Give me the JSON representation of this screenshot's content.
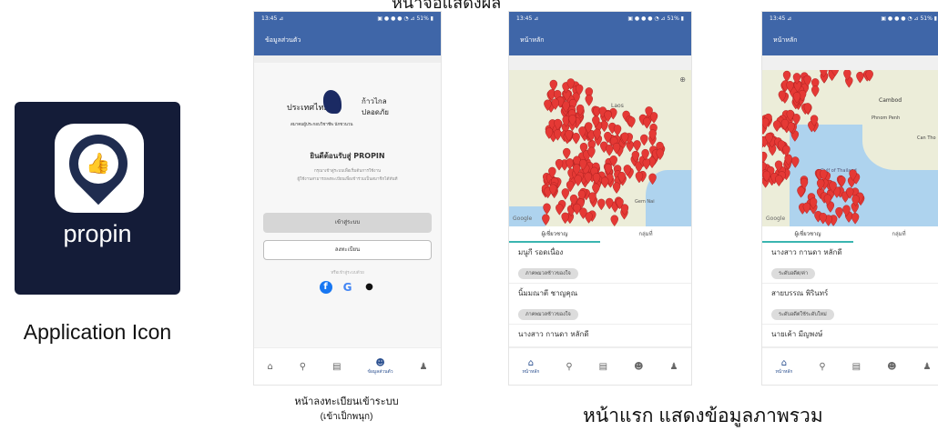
{
  "app_icon": {
    "name": "propin",
    "caption": "Application Icon"
  },
  "header_fragment": "หน้าจอแสดงผล",
  "phone1": {
    "status_time": "13:45 ⊿",
    "status_icons": "▣ ● ● ● ◔ ⊿ 51% ▮",
    "title": "ข้อมูลส่วนตัว",
    "logo_text": {
      "line1": "ประเทศไทย",
      "line2": "ก้าวไกล",
      "line3": "ปลอดภัย",
      "org": "สมาคมผู้ประกอบวิชาชีพ นักชวนวน"
    },
    "welcome": "ยินดีต้อนรับสู่ PROPIN",
    "desc1": "กรุณาเข้าสู่ระบบเพื่อเริ่มต้นการใช้งาน",
    "desc2": "ผู้ใช้งานสามารถลงทะเบียนเพื่อเข้าร่วมเป็นสมาชิกได้ทันที",
    "login_button": "เข้าสู่ระบบ",
    "register_button": "ลงทะเบียน",
    "or_text": "หรือเข้าสู่ระบบด้วย",
    "nav_profile_label": "ข้อมูลส่วนตัว",
    "caption_line1": "หน้าลงทะเบียนเข้าระบบ",
    "caption_line2": "(เข้าเป็กพนุก)"
  },
  "phone2": {
    "status_time": "13:45 ⊿",
    "status_icons": "▣ ● ● ● ◔ ⊿ 51% ▮",
    "title": "หน้าหลัก",
    "map_label": "Laos",
    "map_label2": "Gem Nai",
    "google": "Google",
    "tabs": [
      "ผู้เชี่ยวชาญ",
      "กลุ่มที่"
    ],
    "items": [
      {
        "name": "มนูกี รอดเนื่อง",
        "chip": "ภาคพมวลช้าวของใจ"
      },
      {
        "name": "นิ้มมณาตี ชาญคุณ",
        "chip": "ภาคพมวลช้าวของใจ"
      },
      {
        "name": "นางสาว กานดา หลักดี",
        "chip": ""
      }
    ],
    "nav_home_label": "หน้าหลัก"
  },
  "phone3": {
    "status_time": "13:45 ⊿",
    "status_icons": "▣ ● ● ● ◔ ⊿ 51% ▮",
    "title": "หน้าหลัก",
    "map_label": "Cambod",
    "map_label2": "Phnom Penh",
    "map_label3": "Can Tho",
    "map_label4": "Gulf of Thailand",
    "google": "Google",
    "tabs": [
      "ผู้เชี่ยวชาญ",
      "กลุ่มที่"
    ],
    "items": [
      {
        "name": "นางสาว กานดา หลักดี",
        "chip": "ระดับอดีต/ค่า"
      },
      {
        "name": "สายบรรณ พิรินทร์",
        "chip": "ระดับอดีตใช้ระดับใหม่"
      },
      {
        "name": "นายเค้า มีญพงษ์",
        "chip": ""
      }
    ],
    "nav_home_label": "หน้าหลัก",
    "caption": "หน้าแรก แสดงข้อมูลภาพรวม"
  },
  "colors": {
    "appbar": "#3f66a8",
    "pin": "#e53935",
    "icon_bg": "#141c38",
    "tab_accent": "#3ab5b0"
  }
}
